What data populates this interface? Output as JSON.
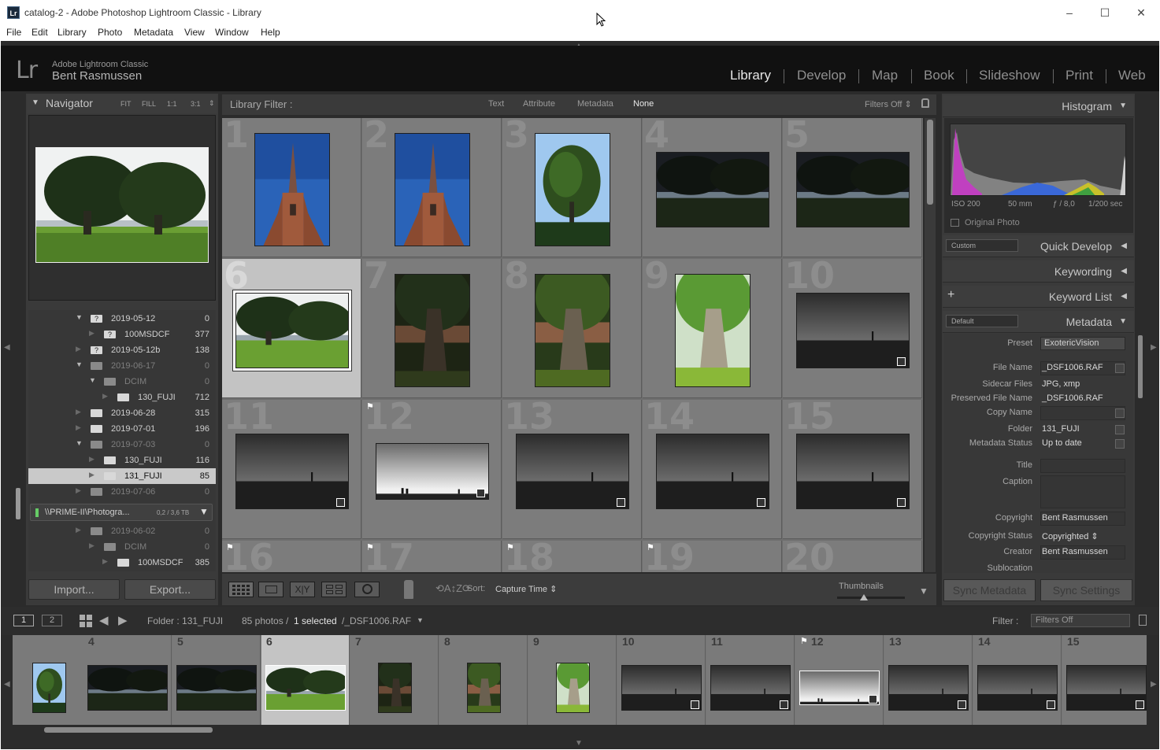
{
  "window": {
    "title": "catalog-2 - Adobe Photoshop Lightroom Classic - Library",
    "icon_text": "Lr",
    "minimize": "–",
    "maximize": "☐",
    "close": "✕"
  },
  "menu": [
    "File",
    "Edit",
    "Library",
    "Photo",
    "Metadata",
    "View",
    "Window",
    "Help"
  ],
  "identity": {
    "logo": "Lr",
    "app_name": "Adobe Lightroom Classic",
    "user": "Bent Rasmussen"
  },
  "modules": [
    "Library",
    "Develop",
    "Map",
    "Book",
    "Slideshow",
    "Print",
    "Web"
  ],
  "active_module": "Library",
  "navigator": {
    "title": "Navigator",
    "zoom_options": [
      "FIT",
      "FILL",
      "1:1",
      "3:1"
    ]
  },
  "folders": [
    {
      "name": "2019-05-12",
      "count": "0",
      "indent": 0,
      "icon": "question-folder",
      "expanded": true,
      "dim": false
    },
    {
      "name": "100MSDCF",
      "count": "377",
      "indent": 1,
      "icon": "question-folder",
      "expanded": false,
      "dim": false
    },
    {
      "name": "2019-05-12b",
      "count": "138",
      "indent": 0,
      "icon": "question-folder",
      "expanded": false,
      "dim": false
    },
    {
      "name": "2019-06-17",
      "count": "0",
      "indent": 0,
      "icon": "folder",
      "expanded": true,
      "dim": true
    },
    {
      "name": "DCIM",
      "count": "0",
      "indent": 1,
      "icon": "folder",
      "expanded": true,
      "dim": true
    },
    {
      "name": "130_FUJI",
      "count": "712",
      "indent": 2,
      "icon": "folder",
      "expanded": false,
      "dim": false
    },
    {
      "name": "2019-06-28",
      "count": "315",
      "indent": 0,
      "icon": "folder",
      "expanded": false,
      "dim": false
    },
    {
      "name": "2019-07-01",
      "count": "196",
      "indent": 0,
      "icon": "folder",
      "expanded": false,
      "dim": false
    },
    {
      "name": "2019-07-03",
      "count": "0",
      "indent": 0,
      "icon": "folder",
      "expanded": true,
      "dim": true
    },
    {
      "name": "130_FUJI",
      "count": "116",
      "indent": 1,
      "icon": "folder",
      "expanded": false,
      "dim": false
    },
    {
      "name": "131_FUJI",
      "count": "85",
      "indent": 1,
      "icon": "folder",
      "expanded": false,
      "dim": false,
      "selected": true
    },
    {
      "name": "2019-07-06",
      "count": "0",
      "indent": 0,
      "icon": "folder",
      "expanded": false,
      "dim": true
    }
  ],
  "volume": {
    "name": "\\\\PRIME-II\\Photogra...",
    "usage": "0,2 / 3,6 TB"
  },
  "folders2": [
    {
      "name": "2019-06-02",
      "count": "0",
      "indent": 0,
      "dim": true
    },
    {
      "name": "DCIM",
      "count": "0",
      "indent": 1,
      "dim": true
    },
    {
      "name": "100MSDCF",
      "count": "385",
      "indent": 2,
      "dim": false
    }
  ],
  "left_buttons": {
    "import": "Import...",
    "export": "Export..."
  },
  "library_filter": {
    "label": "Library Filter :",
    "options": [
      "Text",
      "Attribute",
      "Metadata",
      "None"
    ],
    "active": "None",
    "filters_off": "Filters Off ⇕"
  },
  "grid": [
    {
      "n": "1",
      "kind": "church"
    },
    {
      "n": "2",
      "kind": "church"
    },
    {
      "n": "3",
      "kind": "tree-sky"
    },
    {
      "n": "4",
      "kind": "tree-dark"
    },
    {
      "n": "5",
      "kind": "tree-dark"
    },
    {
      "n": "6",
      "kind": "tree-bright",
      "selected": true
    },
    {
      "n": "7",
      "kind": "trunk-dark"
    },
    {
      "n": "8",
      "kind": "trunk-mid"
    },
    {
      "n": "9",
      "kind": "trunk-bright"
    },
    {
      "n": "10",
      "kind": "sea"
    },
    {
      "n": "11",
      "kind": "sea"
    },
    {
      "n": "12",
      "kind": "sea-light",
      "flag": true
    },
    {
      "n": "13",
      "kind": "sea"
    },
    {
      "n": "14",
      "kind": "sea"
    },
    {
      "n": "15",
      "kind": "sea"
    },
    {
      "n": "16",
      "kind": "none",
      "flag": true
    },
    {
      "n": "17",
      "kind": "none",
      "flag": true
    },
    {
      "n": "18",
      "kind": "none",
      "flag": true
    },
    {
      "n": "19",
      "kind": "none",
      "flag": true
    },
    {
      "n": "20",
      "kind": "none"
    }
  ],
  "toolbar": {
    "sort_label": "Sort:",
    "sort_value": "Capture Time ⇕",
    "thumbnails_label": "Thumbnails",
    "thumbnail_size": 0.4
  },
  "histogram": {
    "title": "Histogram",
    "iso": "ISO 200",
    "focal": "50 mm",
    "aperture": "ƒ / 8,0",
    "shutter": "1/200 sec",
    "original_photo": "Original Photo"
  },
  "quick_develop": {
    "preset": "Custom",
    "title": "Quick Develop"
  },
  "keywording": {
    "title": "Keywording"
  },
  "keyword_list": {
    "title": "Keyword List",
    "add": "+"
  },
  "metadata": {
    "preset_select": "Default",
    "title": "Metadata",
    "preset_label": "Preset",
    "preset_value": "ExotericVision",
    "fields": [
      {
        "label": "File Name",
        "value": "_DSF1006.RAF",
        "box": true
      },
      {
        "label": "Sidecar Files",
        "value": "JPG, xmp",
        "box": false
      },
      {
        "label": "Preserved File Name",
        "value": "_DSF1006.RAF",
        "box": false
      },
      {
        "label": "Copy Name",
        "value": "",
        "box": true
      },
      {
        "label": "Folder",
        "value": "131_FUJI",
        "box": false
      },
      {
        "label": "Metadata Status",
        "value": "Up to date",
        "box": false
      },
      {
        "label": "Title",
        "value": "",
        "box": true
      },
      {
        "label": "Caption",
        "value": "",
        "box": true
      },
      {
        "label": "Copyright",
        "value": "Bent Rasmussen",
        "box": true
      },
      {
        "label": "Copyright Status",
        "value": "Copyrighted ⇕",
        "box": false
      },
      {
        "label": "Creator",
        "value": "Bent Rasmussen",
        "box": true
      },
      {
        "label": "Sublocation",
        "value": "",
        "box": false
      }
    ]
  },
  "sync": {
    "metadata": "Sync Metadata",
    "settings": "Sync Settings"
  },
  "filmstrip_bar": {
    "view1": "1",
    "view2": "2",
    "folder": "Folder : 131_FUJI",
    "count_prefix": "85 photos /",
    "selected": "1 selected",
    "file": "/_DSF1006.RAF",
    "filter_label": "Filter :",
    "filter_value": "Filters Off"
  },
  "filmstrip": [
    {
      "n": "",
      "kind": "tree-sky"
    },
    {
      "n": "4",
      "kind": "tree-dark"
    },
    {
      "n": "5",
      "kind": "tree-dark"
    },
    {
      "n": "6",
      "kind": "tree-bright",
      "selected": true
    },
    {
      "n": "7",
      "kind": "trunk-dark"
    },
    {
      "n": "8",
      "kind": "trunk-mid"
    },
    {
      "n": "9",
      "kind": "trunk-bright"
    },
    {
      "n": "10",
      "kind": "sea"
    },
    {
      "n": "11",
      "kind": "sea"
    },
    {
      "n": "12",
      "kind": "sea-light",
      "flag": true
    },
    {
      "n": "13",
      "kind": "sea"
    },
    {
      "n": "14",
      "kind": "sea"
    },
    {
      "n": "15",
      "kind": "sea"
    }
  ]
}
